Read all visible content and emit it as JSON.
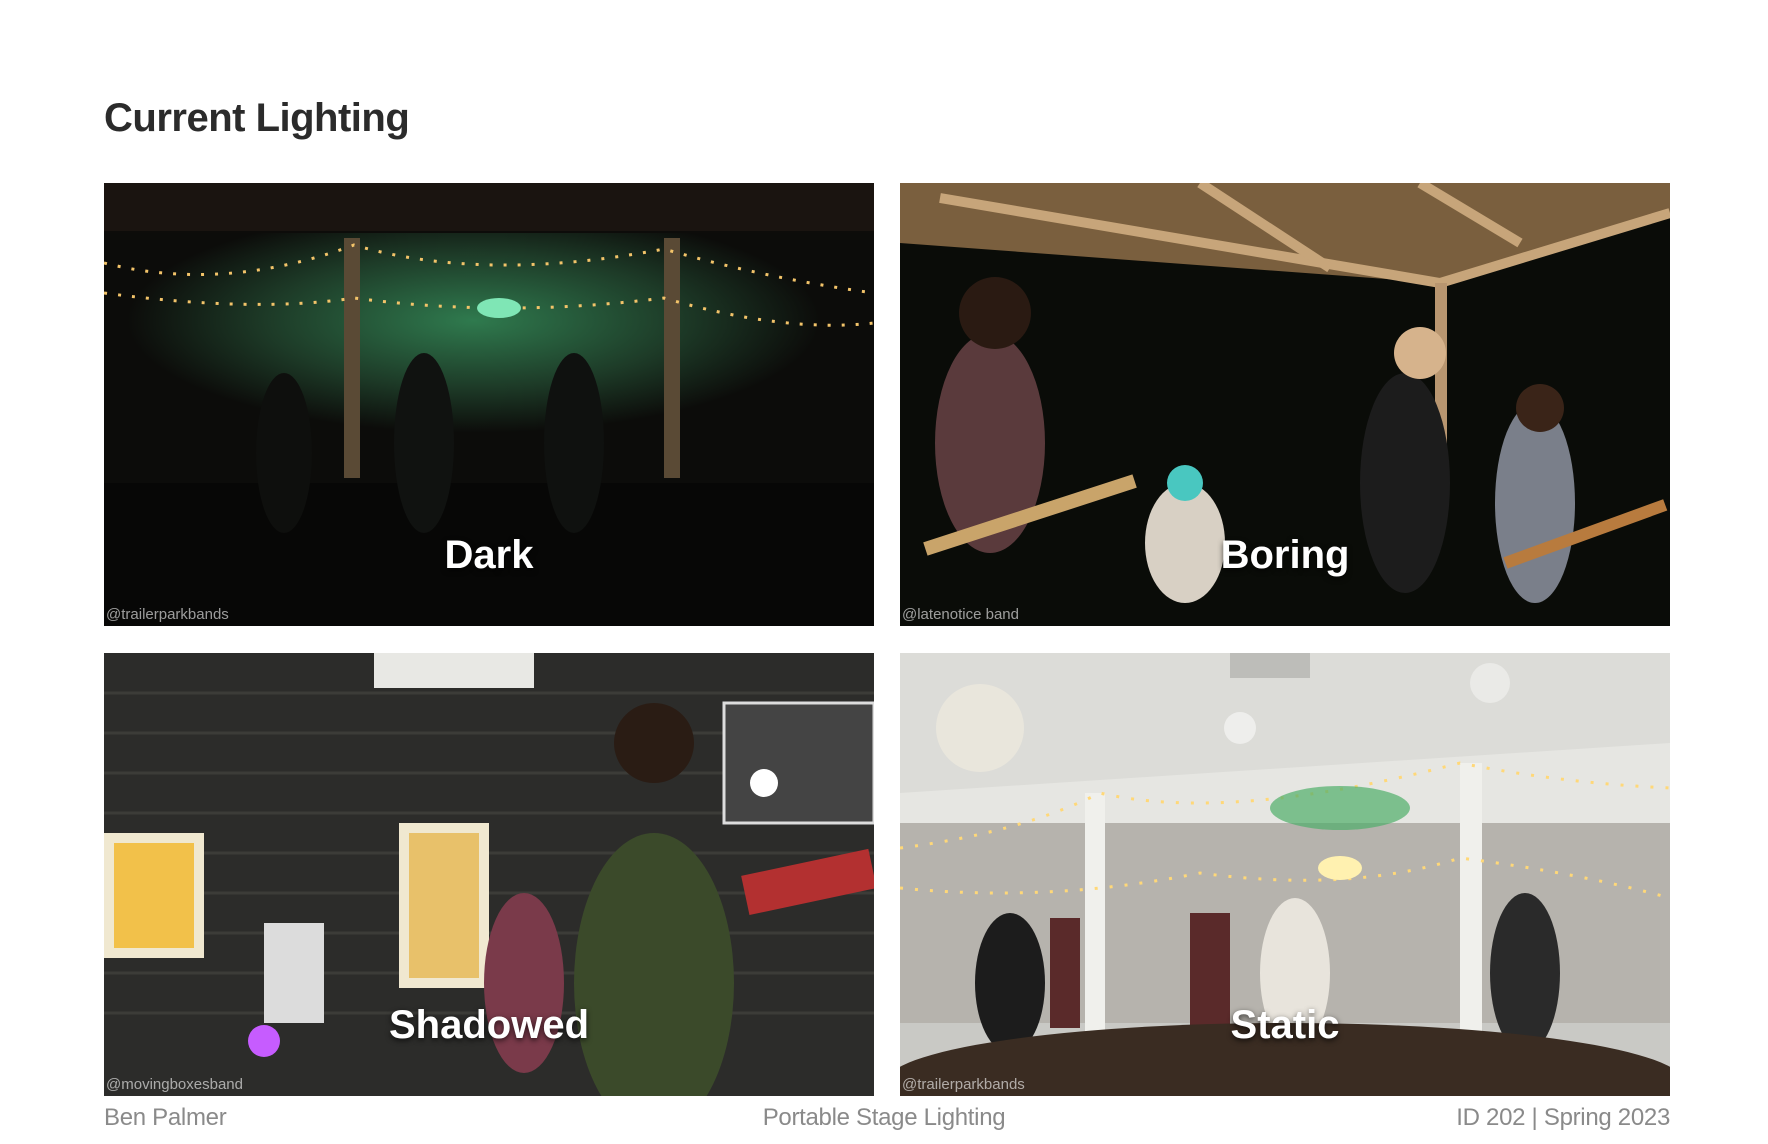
{
  "slide": {
    "title": "Current Lighting"
  },
  "photos": [
    {
      "caption": "Dark",
      "credit": "@trailerparkbands"
    },
    {
      "caption": "Boring",
      "credit": "@latenotice band"
    },
    {
      "caption": "Shadowed",
      "credit": "@movingboxesband"
    },
    {
      "caption": "Static",
      "credit": "@trailerparkbands"
    }
  ],
  "footer": {
    "author": "Ben Palmer",
    "project": "Portable Stage Lighting",
    "course": "ID 202 | Spring 2023"
  }
}
